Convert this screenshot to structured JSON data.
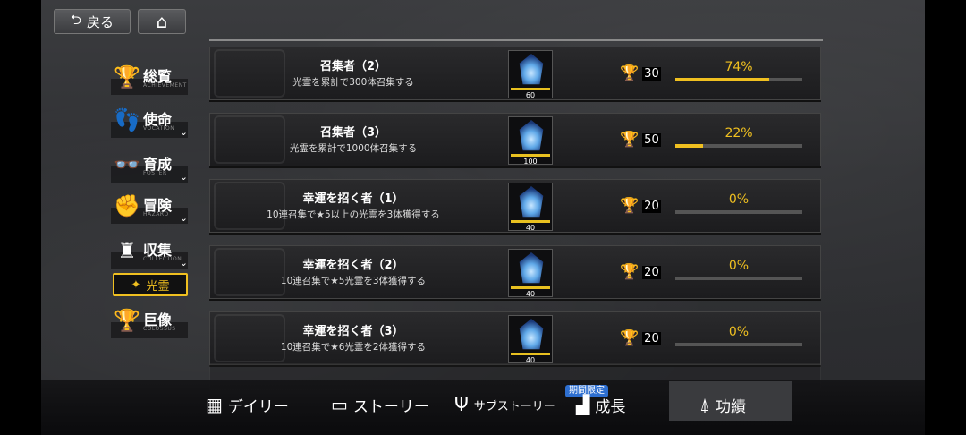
{
  "top": {
    "back_label": "戻る"
  },
  "side_menu": [
    {
      "label": "総覧",
      "sub": "ACHIEVEMENT"
    },
    {
      "label": "使命",
      "sub": "VOCATION"
    },
    {
      "label": "育成",
      "sub": "FOSTER"
    },
    {
      "label": "冒険",
      "sub": "HAZARD"
    },
    {
      "label": "収集",
      "sub": "COLLECTION"
    },
    {
      "label": "光霊",
      "sub": ""
    },
    {
      "label": "巨像",
      "sub": "COLOSSUS"
    }
  ],
  "achievements": [
    {
      "title": "召集者（2）",
      "desc": "光霊を累計で300体召集する",
      "reward_qty": "60",
      "points": "30",
      "progress_text": "74%",
      "progress": 0.74
    },
    {
      "title": "召集者（3）",
      "desc": "光霊を累計で1000体召集する",
      "reward_qty": "100",
      "points": "50",
      "progress_text": "22%",
      "progress": 0.22
    },
    {
      "title": "幸運を招く者（1）",
      "desc": "10連召集で★5以上の光霊を3体獲得する",
      "reward_qty": "40",
      "points": "20",
      "progress_text": "0%",
      "progress": 0
    },
    {
      "title": "幸運を招く者（2）",
      "desc": "10連召集で★5光霊を3体獲得する",
      "reward_qty": "40",
      "points": "20",
      "progress_text": "0%",
      "progress": 0
    },
    {
      "title": "幸運を招く者（3）",
      "desc": "10連召集で★6光霊を2体獲得する",
      "reward_qty": "40",
      "points": "20",
      "progress_text": "0%",
      "progress": 0
    }
  ],
  "bottom_nav": {
    "daily": "デイリー",
    "story": "ストーリー",
    "substory": "サブストーリー",
    "growth": "成長",
    "limited_badge": "期間限定",
    "achievements": "功績"
  },
  "colors": {
    "accent": "#f0c020",
    "badge": "#2e6fd0"
  }
}
